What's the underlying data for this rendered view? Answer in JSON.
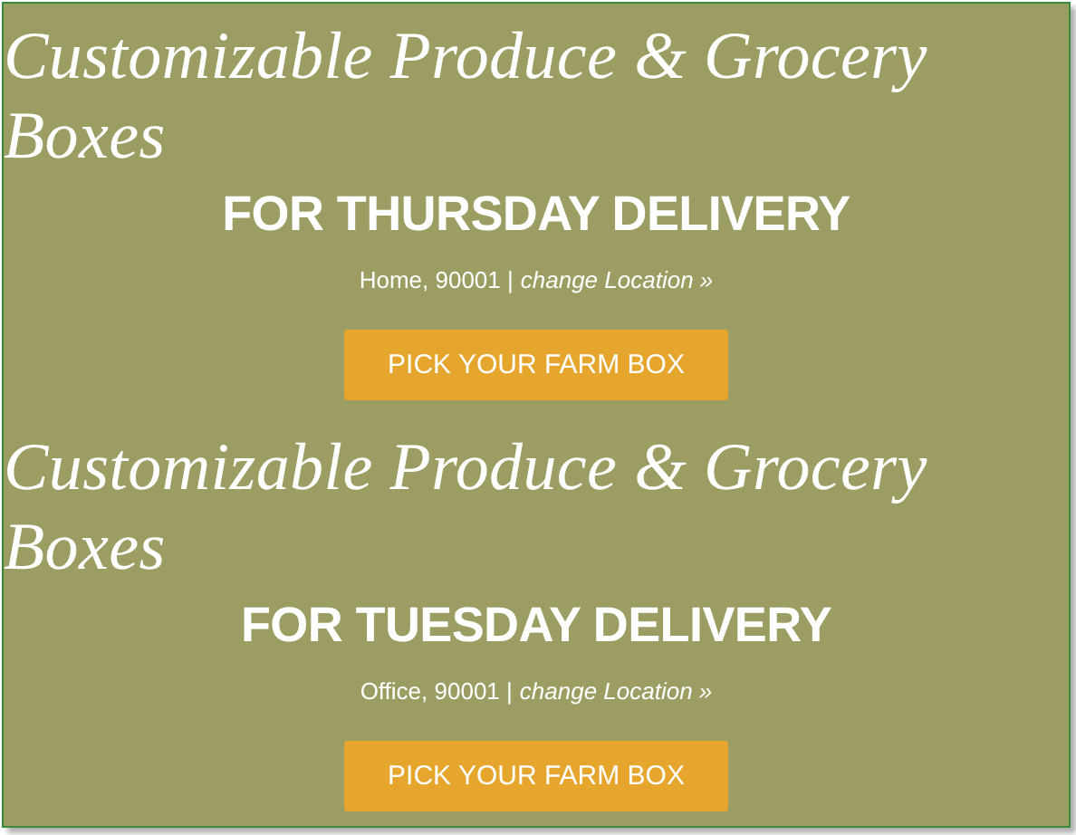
{
  "offers": [
    {
      "title": "Customizable Produce & Grocery Boxes",
      "headline": "FOR THURSDAY DELIVERY",
      "location": "Home, 90001 |",
      "link": "change Location »",
      "button": "PICK YOUR FARM BOX"
    },
    {
      "title": "Customizable Produce & Grocery Boxes",
      "headline": "FOR TUESDAY DELIVERY",
      "location": "Office, 90001 |",
      "link": "change Location »",
      "button": "PICK YOUR FARM BOX"
    }
  ]
}
